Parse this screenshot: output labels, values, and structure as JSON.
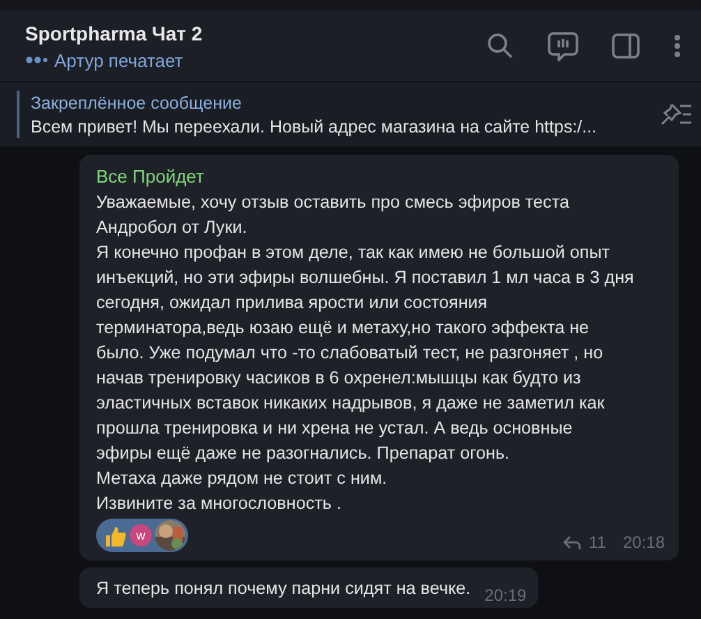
{
  "header": {
    "title": "Sportpharma Чат 2",
    "typing": "Артур печатает"
  },
  "pinned": {
    "label": "Закреплённое сообщение",
    "text": "Всем привет! Мы переехали. Новый адрес магазина на сайте https:/..."
  },
  "messages": [
    {
      "author": "Все Пройдет",
      "lines": [
        "Уважаемые, хочу отзыв оставить про смесь эфиров теста",
        "Андробол от Луки.",
        "Я конечно профан в этом деле, так как имею не большой опыт",
        "инъекций, но эти эфиры волшебны. Я поставил 1 мл часа в 3 дня",
        "сегодня, ожидал прилива ярости или состояния",
        "терминатора,ведь юзаю ещё и метаху,но такого эффекта не",
        "было. Уже подумал что -то слабоватый тест, не разгоняет , но",
        "начав тренировку часиков в 6 охренел:мышцы как будто из",
        "эластичных вставок никаких надрывов, я даже не заметил как",
        "прошла тренировка и ни хрена не устал. А ведь основные",
        "эфиры ещё даже не разогнались. Препарат огонь.",
        "Метаха даже рядом не стоит с ним.",
        "Извините за многословность ."
      ],
      "reaction_avatar": "w",
      "replies": "11",
      "time": "20:18"
    },
    {
      "lines": [
        "Я теперь понял почему парни сидят на вечке."
      ],
      "time": "20:19"
    }
  ]
}
